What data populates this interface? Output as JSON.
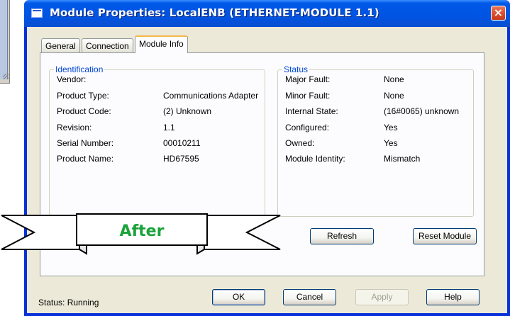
{
  "window": {
    "title": "Module Properties: LocalENB (ETHERNET-MODULE 1.1)",
    "close_label": "×"
  },
  "tabs": [
    {
      "label": "General",
      "active": false
    },
    {
      "label": "Connection",
      "active": false
    },
    {
      "label": "Module Info",
      "active": true
    }
  ],
  "identification": {
    "title": "Identification",
    "rows": [
      {
        "label": "Vendor:",
        "value": ""
      },
      {
        "label": "Product Type:",
        "value": "Communications Adapter"
      },
      {
        "label": "Product Code:",
        "value": "(2) Unknown"
      },
      {
        "label": "Revision:",
        "value": "1.1"
      },
      {
        "label": "Serial Number:",
        "value": "00010211"
      },
      {
        "label": "Product Name:",
        "value": "HD67595"
      }
    ]
  },
  "status_group": {
    "title": "Status",
    "rows": [
      {
        "label": "Major Fault:",
        "value": "None"
      },
      {
        "label": "Minor Fault:",
        "value": "None"
      },
      {
        "label": "Internal State:",
        "value": "(16#0065) unknown"
      },
      {
        "label": "Configured:",
        "value": "Yes"
      },
      {
        "label": "Owned:",
        "value": "Yes"
      },
      {
        "label": "Module Identity:",
        "value": "Mismatch"
      }
    ]
  },
  "buttons": {
    "refresh": "Refresh",
    "reset_module": "Reset Module",
    "ok": "OK",
    "cancel": "Cancel",
    "apply": "Apply",
    "help": "Help"
  },
  "status_bar": {
    "text": "Status:  Running"
  },
  "banner": {
    "label": "After"
  },
  "colors": {
    "group_title": "#0046d5",
    "banner_text": "#1aa33a",
    "titlebar": "#0054e3"
  }
}
